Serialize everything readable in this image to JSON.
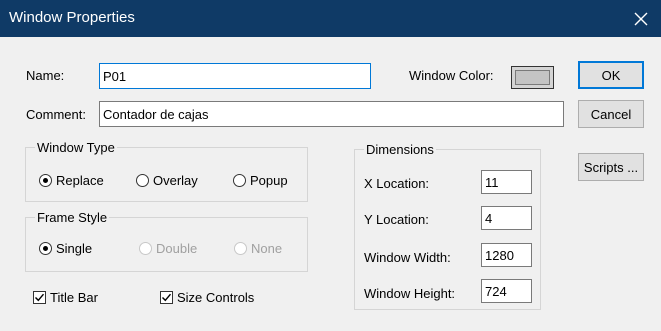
{
  "window": {
    "title": "Window Properties"
  },
  "fields": {
    "name_label": "Name:",
    "name_value": "P01",
    "comment_label": "Comment:",
    "comment_value": "Contador de cajas",
    "window_color_label": "Window Color:"
  },
  "buttons": {
    "ok": "OK",
    "cancel": "Cancel",
    "scripts": "Scripts ..."
  },
  "window_type": {
    "legend": "Window Type",
    "options": [
      "Replace",
      "Overlay",
      "Popup"
    ],
    "selected": "Replace"
  },
  "frame_style": {
    "legend": "Frame Style",
    "options": [
      "Single",
      "Double",
      "None"
    ],
    "selected": "Single"
  },
  "checkboxes": {
    "title_bar": "Title Bar",
    "size_controls": "Size Controls"
  },
  "dimensions": {
    "legend": "Dimensions",
    "x_label": "X Location:",
    "x_value": "11",
    "y_label": "Y Location:",
    "y_value": "4",
    "width_label": "Window Width:",
    "width_value": "1280",
    "height_label": "Window Height:",
    "height_value": "724"
  },
  "colors": {
    "titlebar": "#0f3a66",
    "focus_border": "#0078d7",
    "window_color": "#c4c4c4"
  }
}
